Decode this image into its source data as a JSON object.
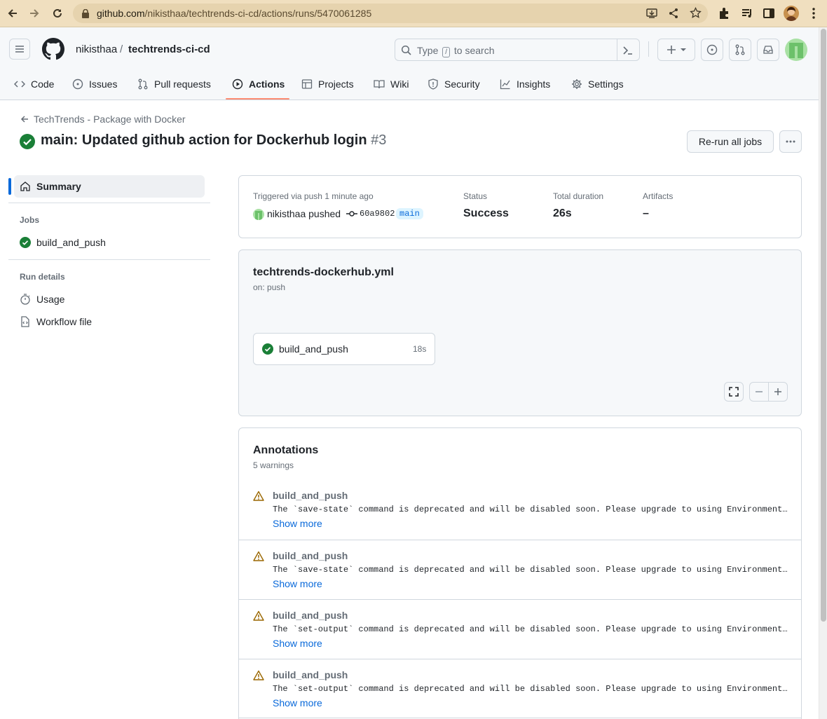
{
  "browser": {
    "url_host": "github.com",
    "url_path": "/nikisthaa/techtrends-ci-cd/actions/runs/5470061285"
  },
  "header": {
    "owner": "nikisthaa",
    "slash": "/",
    "repo": "techtrends-ci-cd",
    "search_prefix": "Type",
    "search_key": "/",
    "search_suffix": "to search"
  },
  "tabs": [
    {
      "label": "Code",
      "icon": "code-icon"
    },
    {
      "label": "Issues",
      "icon": "issue-icon"
    },
    {
      "label": "Pull requests",
      "icon": "pull-request-icon"
    },
    {
      "label": "Actions",
      "icon": "play-icon",
      "active": true
    },
    {
      "label": "Projects",
      "icon": "table-icon"
    },
    {
      "label": "Wiki",
      "icon": "book-icon"
    },
    {
      "label": "Security",
      "icon": "shield-icon"
    },
    {
      "label": "Insights",
      "icon": "graph-icon"
    },
    {
      "label": "Settings",
      "icon": "gear-icon"
    }
  ],
  "run": {
    "back_label": "TechTrends - Package with Docker",
    "title": "main: Updated github action for Dockerhub login",
    "number": "#3",
    "rerun_label": "Re-run all jobs"
  },
  "sidebar": {
    "summary": "Summary",
    "jobs_heading": "Jobs",
    "job": "build_and_push",
    "run_details_heading": "Run details",
    "usage": "Usage",
    "workflow_file": "Workflow file"
  },
  "summary": {
    "triggered": "Triggered via push 1 minute ago",
    "actor": "nikisthaa pushed",
    "commit": "60a9802",
    "branch": "main",
    "status_label": "Status",
    "status_value": "Success",
    "duration_label": "Total duration",
    "duration_value": "26s",
    "artifacts_label": "Artifacts",
    "artifacts_value": "–"
  },
  "workflow": {
    "file": "techtrends-dockerhub.yml",
    "trigger": "on: push",
    "job_name": "build_and_push",
    "job_duration": "18s"
  },
  "annotations": {
    "title": "Annotations",
    "count": "5 warnings",
    "show_more": "Show more",
    "items": [
      {
        "job": "build_and_push",
        "message": "The `save-state` command is deprecated and will be disabled soon. Please upgrade to using Environment Files."
      },
      {
        "job": "build_and_push",
        "message": "The `save-state` command is deprecated and will be disabled soon. Please upgrade to using Environment Files."
      },
      {
        "job": "build_and_push",
        "message": "The `set-output` command is deprecated and will be disabled soon. Please upgrade to using Environment Files."
      },
      {
        "job": "build_and_push",
        "message": "The `set-output` command is deprecated and will be disabled soon. Please upgrade to using Environment Files."
      }
    ]
  },
  "colors": {
    "success": "#1a7f37",
    "link": "#0969da",
    "warning": "#9a6700",
    "active_tab": "#fd8c73"
  }
}
